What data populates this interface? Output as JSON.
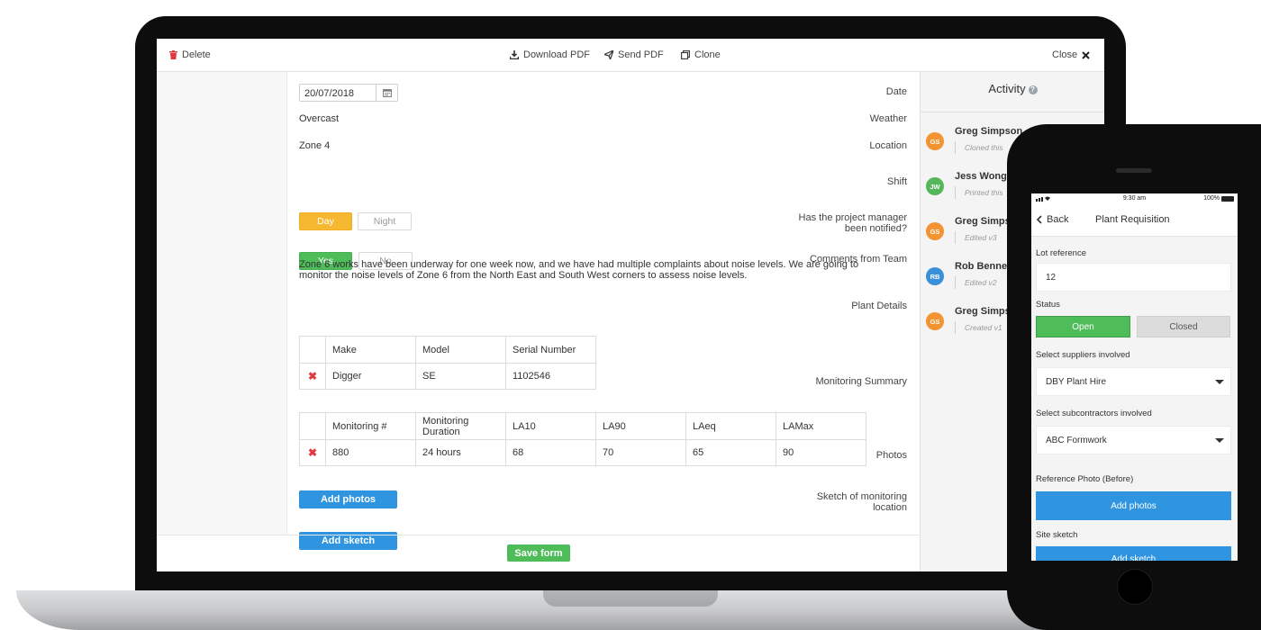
{
  "toolbar": {
    "delete": "Delete",
    "download_pdf": "Download PDF",
    "send_pdf": "Send PDF",
    "clone": "Clone",
    "close": "Close"
  },
  "form": {
    "date": {
      "label": "Date",
      "value": "20/07/2018"
    },
    "weather": {
      "label": "Weather",
      "value": "Overcast"
    },
    "location": {
      "label": "Location",
      "value": "Zone 4"
    },
    "shift": {
      "label": "Shift",
      "options": [
        "Day",
        "Night"
      ],
      "selected": "Day"
    },
    "notified": {
      "label_line1": "Has the project manager",
      "label_line2": "been notified?",
      "options": [
        "Yes",
        "No"
      ],
      "selected": "Yes"
    },
    "comments": {
      "label": "Comments from Team",
      "value": "Zone 6 works have been underway for one week now, and we have had multiple complaints about noise levels. We are going to monitor the noise levels of Zone 6 from the North East and South West corners to assess noise levels."
    },
    "plant": {
      "label": "Plant Details",
      "headers": [
        "Make",
        "Model",
        "Serial Number"
      ],
      "rows": [
        [
          "Digger",
          "SE",
          "1102546"
        ]
      ]
    },
    "monitoring": {
      "label": "Monitoring Summary",
      "headers": [
        "Monitoring #",
        "Monitoring Duration",
        "LA10",
        "LA90",
        "LAeq",
        "LAMax"
      ],
      "rows": [
        [
          "880",
          "24 hours",
          "68",
          "70",
          "65",
          "90"
        ]
      ]
    },
    "photos": {
      "label": "Photos",
      "button": "Add photos"
    },
    "sketch": {
      "label_line1": "Sketch of monitoring",
      "label_line2": "location",
      "button": "Add sketch"
    },
    "save": "Save form"
  },
  "activity": {
    "title": "Activity",
    "items": [
      {
        "initials": "GS",
        "name": "Greg Simpson",
        "note": "Cloned this",
        "color": "#f39332"
      },
      {
        "initials": "JW",
        "name": "Jess Wong",
        "note": "Printed this",
        "color": "#56b65b"
      },
      {
        "initials": "GS",
        "name": "Greg Simpson",
        "note": "Edited v3",
        "color": "#f39332"
      },
      {
        "initials": "RB",
        "name": "Rob Bennett",
        "note": "Edited v2",
        "color": "#3a8fd9"
      },
      {
        "initials": "GS",
        "name": "Greg Simpson",
        "note": "Created v1",
        "color": "#f39332"
      }
    ]
  },
  "phone": {
    "time": "9:30 am",
    "battery": "100%",
    "back": "Back",
    "title": "Plant Requisition",
    "lot_label": "Lot reference",
    "lot_value": "12",
    "status_label": "Status",
    "status_open": "Open",
    "status_closed": "Closed",
    "suppliers_label": "Select suppliers involved",
    "suppliers_value": "DBY Plant Hire",
    "subcontractors_label": "Select subcontractors involved",
    "subcontractors_value": "ABC Formwork",
    "ref_photo_label": "Reference Photo (Before)",
    "add_photos": "Add photos",
    "site_sketch_label": "Site sketch",
    "add_sketch": "Add sketch"
  },
  "colors": {
    "accent_blue": "#2f95e0",
    "green": "#4fbc5a",
    "yellow": "#f6b731",
    "delete_red": "#e0393e"
  }
}
